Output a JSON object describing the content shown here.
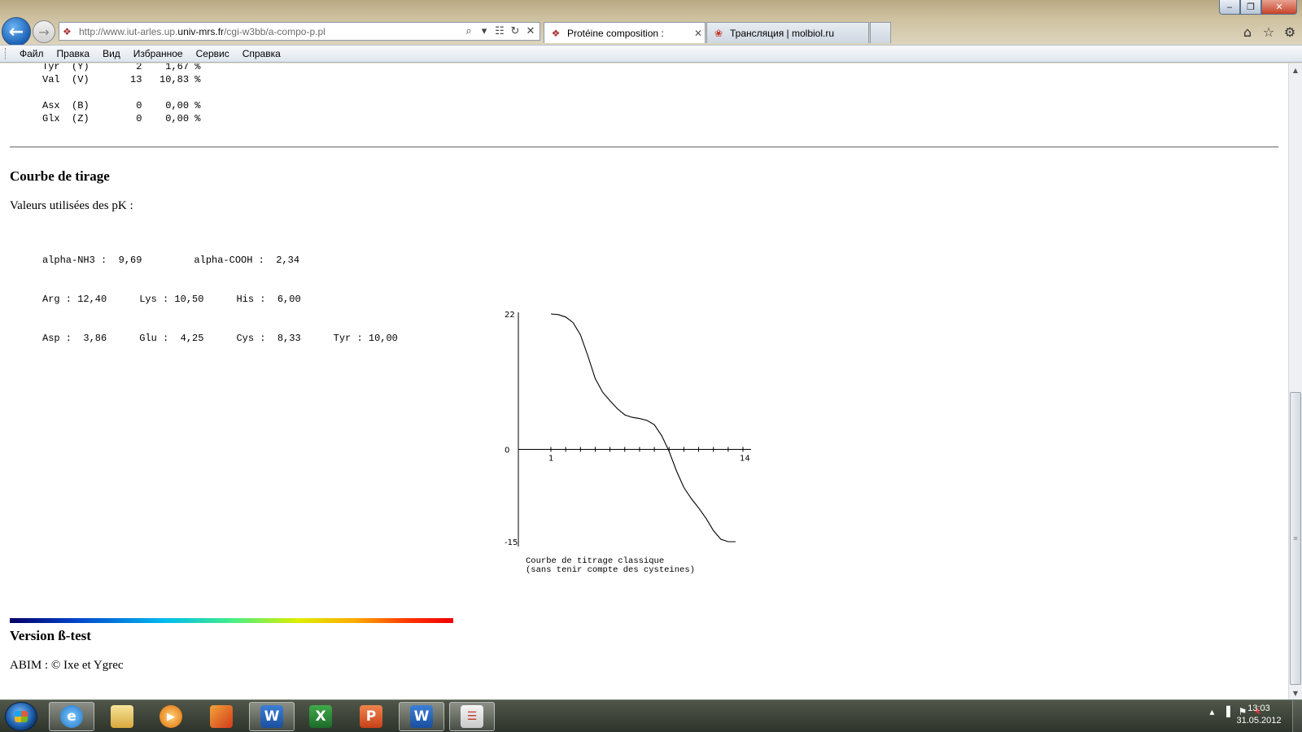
{
  "window": {
    "minimize": "‒",
    "restore": "❐",
    "close": "✕"
  },
  "address": {
    "url_prefix": "http://www.iut-arles.up.",
    "url_domain": "univ-mrs.fr",
    "url_suffix": "/cgi-w3bb/a-compo-p.pl"
  },
  "tabs": [
    {
      "label": "Protéine composition :",
      "active": true
    },
    {
      "label": "Трансляция | molbiol.ru",
      "active": false
    }
  ],
  "menu": [
    "Файл",
    "Правка",
    "Вид",
    "Избранное",
    "Сервис",
    "Справка"
  ],
  "amino_acid_table": [
    {
      "name": "Tyr",
      "code": "(Y)",
      "count": "2",
      "percent": "1,67 %"
    },
    {
      "name": "Val",
      "code": "(V)",
      "count": "13",
      "percent": "10,83 %"
    },
    {
      "name": "",
      "code": "",
      "count": "",
      "percent": ""
    },
    {
      "name": "Asx",
      "code": "(B)",
      "count": "0",
      "percent": "0,00 %"
    },
    {
      "name": "Glx",
      "code": "(Z)",
      "count": "0",
      "percent": "0,00 %"
    }
  ],
  "section": {
    "title": "Courbe de tirage",
    "pk_intro": "Valeurs utilisées des pK :"
  },
  "pk_values": {
    "alpha_nh3": "alpha-NH3 :  9,69",
    "alpha_cooh": "alpha-COOH :  2,34",
    "arg": "Arg : 12,40",
    "lys": "Lys : 10,50",
    "his": "His :  6,00",
    "asp": "Asp :  3,86",
    "glu": "Glu :  4,25",
    "cys": "Cys :  8,33",
    "tyr": "Tyr : 10,00"
  },
  "chart_data": {
    "type": "line",
    "title": "",
    "xlabel": "",
    "ylabel": "",
    "xlim": [
      1,
      14
    ],
    "ylim": [
      -15,
      22
    ],
    "x_tick_labels": [
      "1",
      "14"
    ],
    "y_tick_labels": [
      "22",
      "0",
      "-15"
    ],
    "x_minor_ticks": [
      1,
      2,
      3,
      4,
      5,
      6,
      7,
      8,
      9,
      10,
      11,
      12,
      13,
      14
    ],
    "grid": false,
    "series": [
      {
        "x": [
          1,
          1.5,
          2,
          2.5,
          3,
          3.5,
          4,
          4.5,
          5,
          5.5,
          6,
          6.5,
          7,
          7.5,
          8,
          8.5,
          9,
          9.5,
          10,
          10.5,
          11,
          11.5,
          12,
          12.5,
          13,
          13.5,
          14
        ],
        "y": [
          22,
          21.9,
          21.5,
          20.6,
          18.6,
          15.2,
          11.5,
          9.3,
          7.9,
          6.6,
          5.6,
          5.2,
          5.0,
          4.7,
          4.0,
          2.2,
          -0.3,
          -3.5,
          -6.2,
          -8.0,
          -9.5,
          -11.2,
          -13.2,
          -14.6,
          -15,
          -15,
          -15
        ]
      }
    ],
    "caption_line1": "Courbe de titrage classique",
    "caption_line2": "(sans tenir compte des cysteines)"
  },
  "footer": {
    "version_title": "Version ß-test",
    "copyright": "ABIM : © Ixe et Ygrec"
  },
  "taskbar": {
    "apps": [
      "internet-explorer",
      "explorer",
      "media-player",
      "office-docs",
      "word",
      "excel",
      "powerpoint",
      "word",
      "other-app"
    ],
    "clock_time": "13:03",
    "clock_date": "31.05.2012"
  }
}
